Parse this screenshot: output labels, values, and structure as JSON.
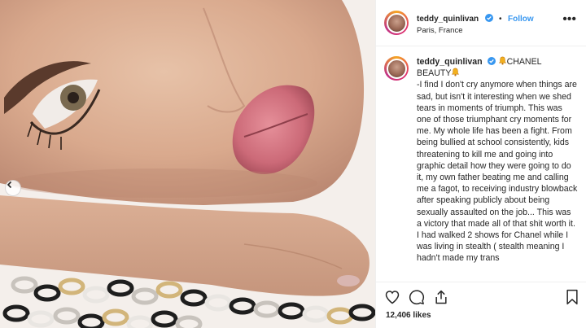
{
  "post": {
    "username": "teddy_quinlivan",
    "follow_label": "Follow",
    "location": "Paris, France",
    "more_label": "•••"
  },
  "caption": {
    "username": "teddy_quinlivan",
    "brand": "CHANEL BEAUTY",
    "text": "-I find I don't cry anymore when things are sad, but isn't it interesting when we shed tears in moments of triumph. This was one of those triumphant cry moments for me. My whole life has been a fight. From being bullied at school consistently, kids threatening to kill me and going into graphic detail how they were going to do it, my own father beating me and calling me a fagot, to receiving industry blowback after speaking publicly about being sexually assaulted on the job... This was a victory that made all of that shit worth it. I had walked 2 shows for Chanel while I was living in stealth ( stealth meaning I hadn't made my trans"
  },
  "stats": {
    "likes": "12,406 likes"
  },
  "icons": {
    "verified": "verified-badge-icon",
    "bell": "bell-emoji-icon",
    "like": "heart-icon",
    "comment": "comment-icon",
    "share": "share-icon",
    "save": "bookmark-icon",
    "carousel_prev": "chevron-left-icon"
  },
  "colors": {
    "follow": "#3897f0",
    "verified": "#3897f0",
    "text": "#262626",
    "border": "#efefef"
  }
}
